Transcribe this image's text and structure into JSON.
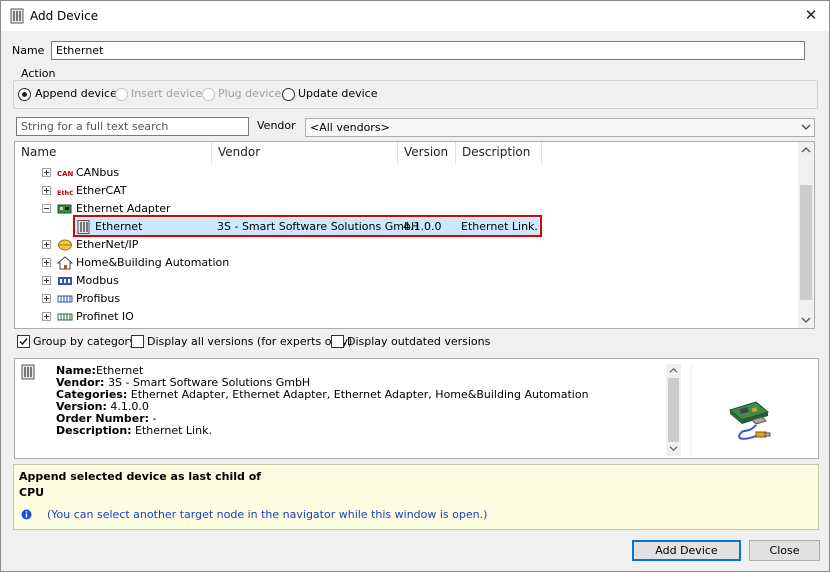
{
  "window": {
    "title": "Add Device",
    "close_glyph": "✕"
  },
  "name_field": {
    "label": "Name",
    "value": "Ethernet"
  },
  "action": {
    "label": "Action",
    "options": [
      {
        "label": "Append device",
        "selected": true,
        "enabled": true
      },
      {
        "label": "Insert device",
        "selected": false,
        "enabled": false
      },
      {
        "label": "Plug device",
        "selected": false,
        "enabled": false
      },
      {
        "label": "Update device",
        "selected": false,
        "enabled": true
      }
    ]
  },
  "search": {
    "placeholder": "String for a full text search",
    "value": ""
  },
  "vendor": {
    "label": "Vendor",
    "selected": "<All vendors>"
  },
  "columns": [
    "Name",
    "Vendor",
    "Version",
    "Description"
  ],
  "tree": [
    {
      "name": "CANbus",
      "icon": "canbus-icon",
      "expanded": false
    },
    {
      "name": "EtherCAT",
      "icon": "ethercat-icon",
      "expanded": false
    },
    {
      "name": "Ethernet Adapter",
      "icon": "ethernet-adapter-icon",
      "expanded": true
    },
    {
      "name": "Ethernet",
      "icon": "device-icon",
      "vendor": "3S - Smart Software Solutions GmbH",
      "version": "4.1.0.0",
      "description": "Ethernet Link.",
      "selected": true
    },
    {
      "name": "EtherNet/IP",
      "icon": "ethernetip-icon",
      "expanded": false
    },
    {
      "name": "Home&Building Automation",
      "icon": "home-icon",
      "expanded": false
    },
    {
      "name": "Modbus",
      "icon": "modbus-icon",
      "expanded": false
    },
    {
      "name": "Profibus",
      "icon": "profibus-icon",
      "expanded": false
    },
    {
      "name": "Profinet IO",
      "icon": "profinet-icon",
      "expanded": false
    }
  ],
  "options": {
    "group_by_category": {
      "label": "Group by category",
      "checked": true
    },
    "display_all_versions": {
      "label": "Display all versions (for experts only)",
      "checked": false
    },
    "display_outdated": {
      "label": "Display outdated versions",
      "checked": false
    }
  },
  "info": {
    "name_label": "Name:",
    "name_value": "Ethernet",
    "vendor_label": "Vendor:",
    "vendor_value": "3S - Smart Software Solutions GmbH",
    "categories_label": "Categories:",
    "categories_value": "Ethernet Adapter, Ethernet Adapter, Ethernet Adapter, Home&Building Automation",
    "version_label": "Version:",
    "version_value": "4.1.0.0",
    "order_label": "Order Number:",
    "order_value": "-",
    "description_label": "Description:",
    "description_value": "Ethernet Link."
  },
  "hint": {
    "line1": "Append selected device as last child of",
    "line2": "CPU",
    "note": "(You can select another target node in the navigator while this window is open.)"
  },
  "buttons": {
    "add_device": "Add Device",
    "close": "Close"
  },
  "colors": {
    "selection": "#cce8ff",
    "highlight_border": "#e00000",
    "hint_bg": "#fdfde1",
    "link_blue": "#1a3fc4"
  }
}
